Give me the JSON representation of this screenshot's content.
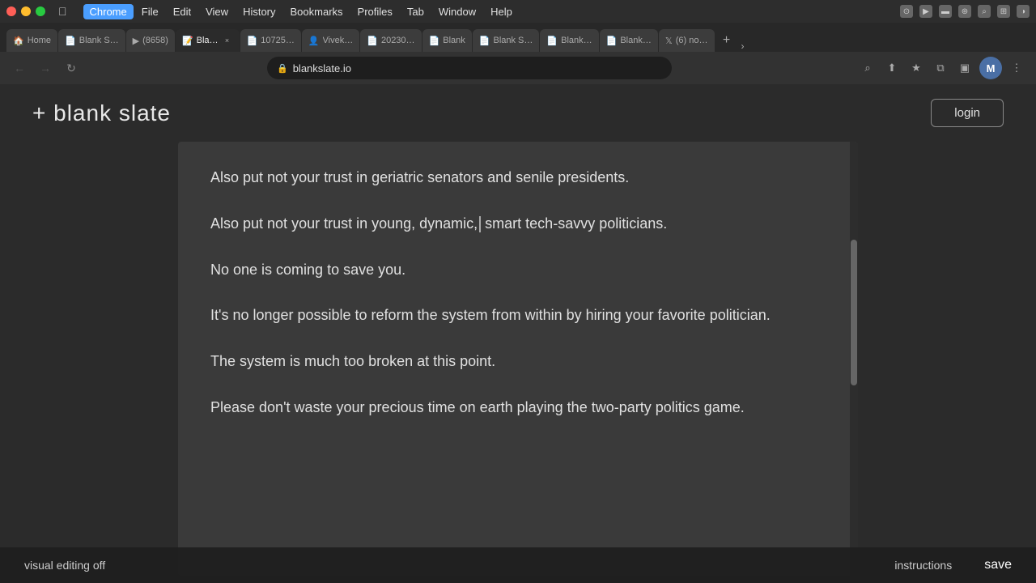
{
  "os": {
    "apple_symbol": "",
    "menu_items": [
      "Chrome",
      "File",
      "Edit",
      "View",
      "History",
      "Bookmarks",
      "Profiles",
      "Tab",
      "Window",
      "Help"
    ]
  },
  "browser": {
    "tabs": [
      {
        "id": "home",
        "label": "Home",
        "favicon": "🏠",
        "active": false
      },
      {
        "id": "blank1",
        "label": "Blank S…",
        "favicon": "📄",
        "active": false
      },
      {
        "id": "youtube",
        "label": "(8658)",
        "favicon": "▶",
        "active": false
      },
      {
        "id": "bla-active",
        "label": "Bla…",
        "favicon": "📝",
        "active": true
      },
      {
        "id": "tab5",
        "label": "10725…",
        "favicon": "📄",
        "active": false
      },
      {
        "id": "vivek",
        "label": "Vivek…",
        "favicon": "👤",
        "active": false
      },
      {
        "id": "tab7",
        "label": "20230…",
        "favicon": "📄",
        "active": false
      },
      {
        "id": "blank2",
        "label": "Blank",
        "favicon": "📄",
        "active": false
      },
      {
        "id": "blank3",
        "label": "Blank S…",
        "favicon": "📄",
        "active": false
      },
      {
        "id": "blank4",
        "label": "Blank…",
        "favicon": "📄",
        "active": false
      },
      {
        "id": "blank5",
        "label": "Blank…",
        "favicon": "📄",
        "active": false
      },
      {
        "id": "twitter",
        "label": "(6) no…",
        "favicon": "𝕏",
        "active": false
      }
    ],
    "url": "blankslate.io",
    "profile_initial": "M"
  },
  "app": {
    "logo": "+ blank slate",
    "login_label": "login",
    "content": {
      "paragraphs": [
        "Also put not your trust in geriatric senators and senile presidents.",
        "Also put not your trust in young, dynamic, smart tech-savvy politicians.",
        "No one is coming to save you.",
        "It's no longer possible to reform the system from within by hiring your favorite politician.",
        "The system is much too broken at this point.",
        "Please don't waste your precious time on earth playing the two-party politics game."
      ]
    },
    "toolbar": {
      "visual_editing": "visual editing off",
      "instructions": "instructions",
      "save": "save"
    }
  }
}
